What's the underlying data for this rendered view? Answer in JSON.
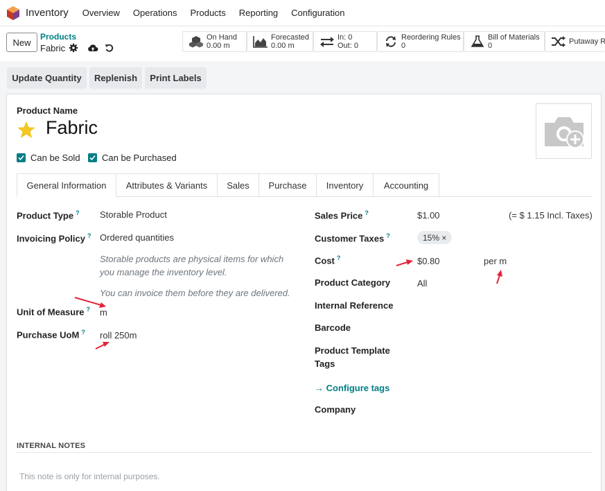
{
  "nav": {
    "app_name": "Inventory",
    "items": [
      "Overview",
      "Operations",
      "Products",
      "Reporting",
      "Configuration"
    ]
  },
  "control_panel": {
    "new_label": "New",
    "breadcrumb_parent": "Products",
    "breadcrumb_current": "Fabric",
    "smart_buttons": [
      {
        "label": "On Hand",
        "value": "0.00 m",
        "icon": "cubes-icon"
      },
      {
        "label": "Forecasted",
        "value": "0.00 m",
        "icon": "area-chart-icon"
      },
      {
        "label": "In: 0",
        "value": "Out: 0",
        "icon": "exchange-icon"
      },
      {
        "label": "Reordering Rules",
        "value": "0",
        "icon": "refresh-icon"
      },
      {
        "label": "Bill of Materials",
        "value": "0",
        "icon": "flask-icon"
      },
      {
        "label": "Putaway Ru",
        "value": "",
        "icon": "random-icon"
      }
    ]
  },
  "actions": [
    "Update Quantity",
    "Replenish",
    "Print Labels"
  ],
  "product": {
    "name_label": "Product Name",
    "name": "Fabric",
    "can_be_sold": "Can be Sold",
    "can_be_purchased": "Can be Purchased"
  },
  "tabs": [
    "General Information",
    "Attributes & Variants",
    "Sales",
    "Purchase",
    "Inventory",
    "Accounting"
  ],
  "left_fields": {
    "product_type_label": "Product Type",
    "product_type_value": "Storable Product",
    "invoicing_policy_label": "Invoicing Policy",
    "invoicing_policy_value": "Ordered quantities",
    "help_line1": "Storable products are physical items for which",
    "help_line2": "you manage the inventory level.",
    "help_line3": "You can invoice them before they are delivered.",
    "uom_label": "Unit of Measure",
    "uom_value": "m",
    "purchase_uom_label": "Purchase UoM",
    "purchase_uom_value": "roll 250m",
    "help_mark": "?"
  },
  "right_fields": {
    "sales_price_label": "Sales Price",
    "sales_price_value": "$1.00",
    "incl_taxes": "(= $ 1.15 Incl. Taxes)",
    "customer_taxes_label": "Customer Taxes",
    "tax_badge": "15% ×",
    "cost_label": "Cost",
    "cost_value": "$0.80",
    "cost_unit": "per m",
    "category_label": "Product Category",
    "category_value": "All",
    "internal_ref_label": "Internal Reference",
    "barcode_label": "Barcode",
    "template_tags_label_1": "Product Template",
    "template_tags_label_2": "Tags",
    "configure_tags": "→ Configure tags",
    "company_label": "Company"
  },
  "notes": {
    "header": "INTERNAL NOTES",
    "placeholder": "This note is only for internal purposes."
  },
  "colors": {
    "accent": "#017e84",
    "annotation_arrow": "#e8223a",
    "star": "#f3c623"
  }
}
